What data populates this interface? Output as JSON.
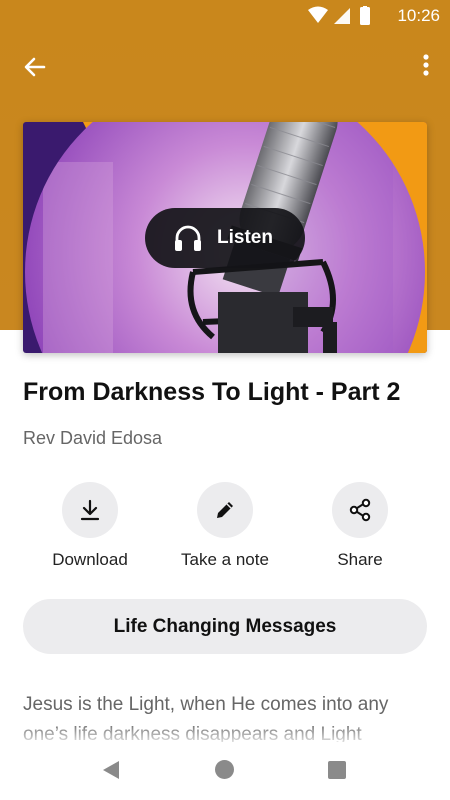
{
  "status_bar": {
    "time": "10:26",
    "icons": [
      "wifi-icon",
      "signal-icon",
      "battery-icon"
    ]
  },
  "toolbar": {
    "back_icon": "arrow-left-icon",
    "menu_icon": "more-vert-icon"
  },
  "player": {
    "listen_label": "Listen",
    "listen_icon": "headphones-icon"
  },
  "sermon": {
    "title": "From Darkness To Light - Part 2",
    "author": "Rev David Edosa",
    "description": "Jesus is the Light, when He comes into any one’s life darkness disappears and Light"
  },
  "actions": [
    {
      "label": "Download",
      "icon": "download-icon"
    },
    {
      "label": "Take a note",
      "icon": "pencil-icon"
    },
    {
      "label": "Share",
      "icon": "share-icon"
    }
  ],
  "collection": {
    "label": "Life Changing Messages"
  },
  "colors": {
    "header": "#c9871c",
    "cover_left": "#3a1a6e",
    "cover_right": "#f29a14",
    "pill": "#141418",
    "chip": "#ececee"
  }
}
